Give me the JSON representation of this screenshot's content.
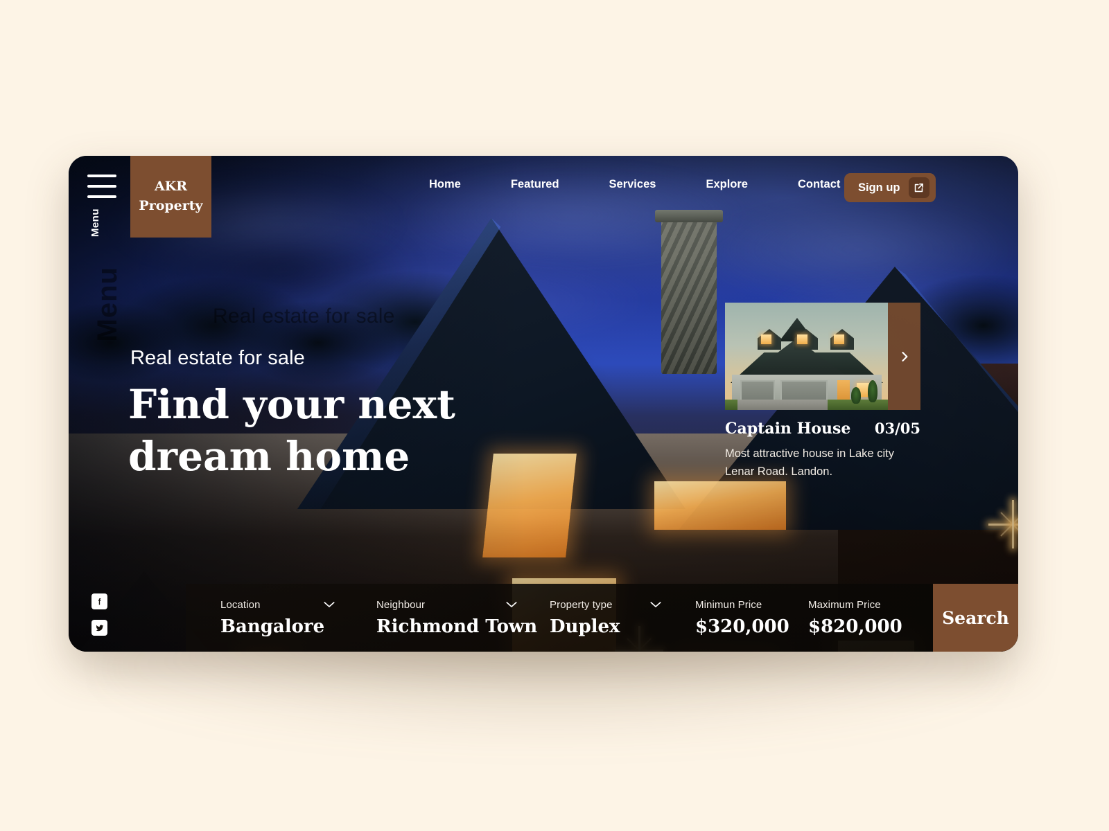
{
  "theme": {
    "page_bg": "#fdf4e6",
    "brand_brown": "#7d4e30",
    "brand_brown_dark": "#5e3822",
    "text_light": "#ffffff"
  },
  "brand": {
    "logo_line1": "AKR",
    "logo_line2": "Property",
    "menu_label": "Menu",
    "menu_ghost_label": "Menu"
  },
  "nav": {
    "items": [
      {
        "label": "Home"
      },
      {
        "label": "Featured"
      },
      {
        "label": "Services"
      },
      {
        "label": "Explore"
      },
      {
        "label": "Contact"
      }
    ],
    "signup_label": "Sign up",
    "signup_icon": "external-link-icon"
  },
  "hero": {
    "kicker": "Real estate for sale",
    "kicker_ghost": "Real estate for sale",
    "headline_line1": "Find your next",
    "headline_line2": "dream home"
  },
  "card": {
    "title": "Captain House",
    "counter": "03/05",
    "description": "Most attractive house in Lake city Lenar Road. Landon.",
    "next_icon": "chevron-right-icon"
  },
  "social": {
    "items": [
      {
        "name": "facebook-icon",
        "glyph": "f"
      },
      {
        "name": "twitter-icon",
        "glyph": "t"
      }
    ]
  },
  "search": {
    "fields": [
      {
        "label": "Location",
        "value": "Bangalore",
        "has_chevron": true
      },
      {
        "label": "Neighbour",
        "value": "Richmond Town",
        "has_chevron": true
      },
      {
        "label": "Property type",
        "value": "Duplex",
        "has_chevron": true
      },
      {
        "label": "Minimun Price",
        "value": "$320,000",
        "has_chevron": false
      },
      {
        "label": "Maximum Price",
        "value": "$820,000",
        "has_chevron": false
      }
    ],
    "button_label": "Search"
  }
}
